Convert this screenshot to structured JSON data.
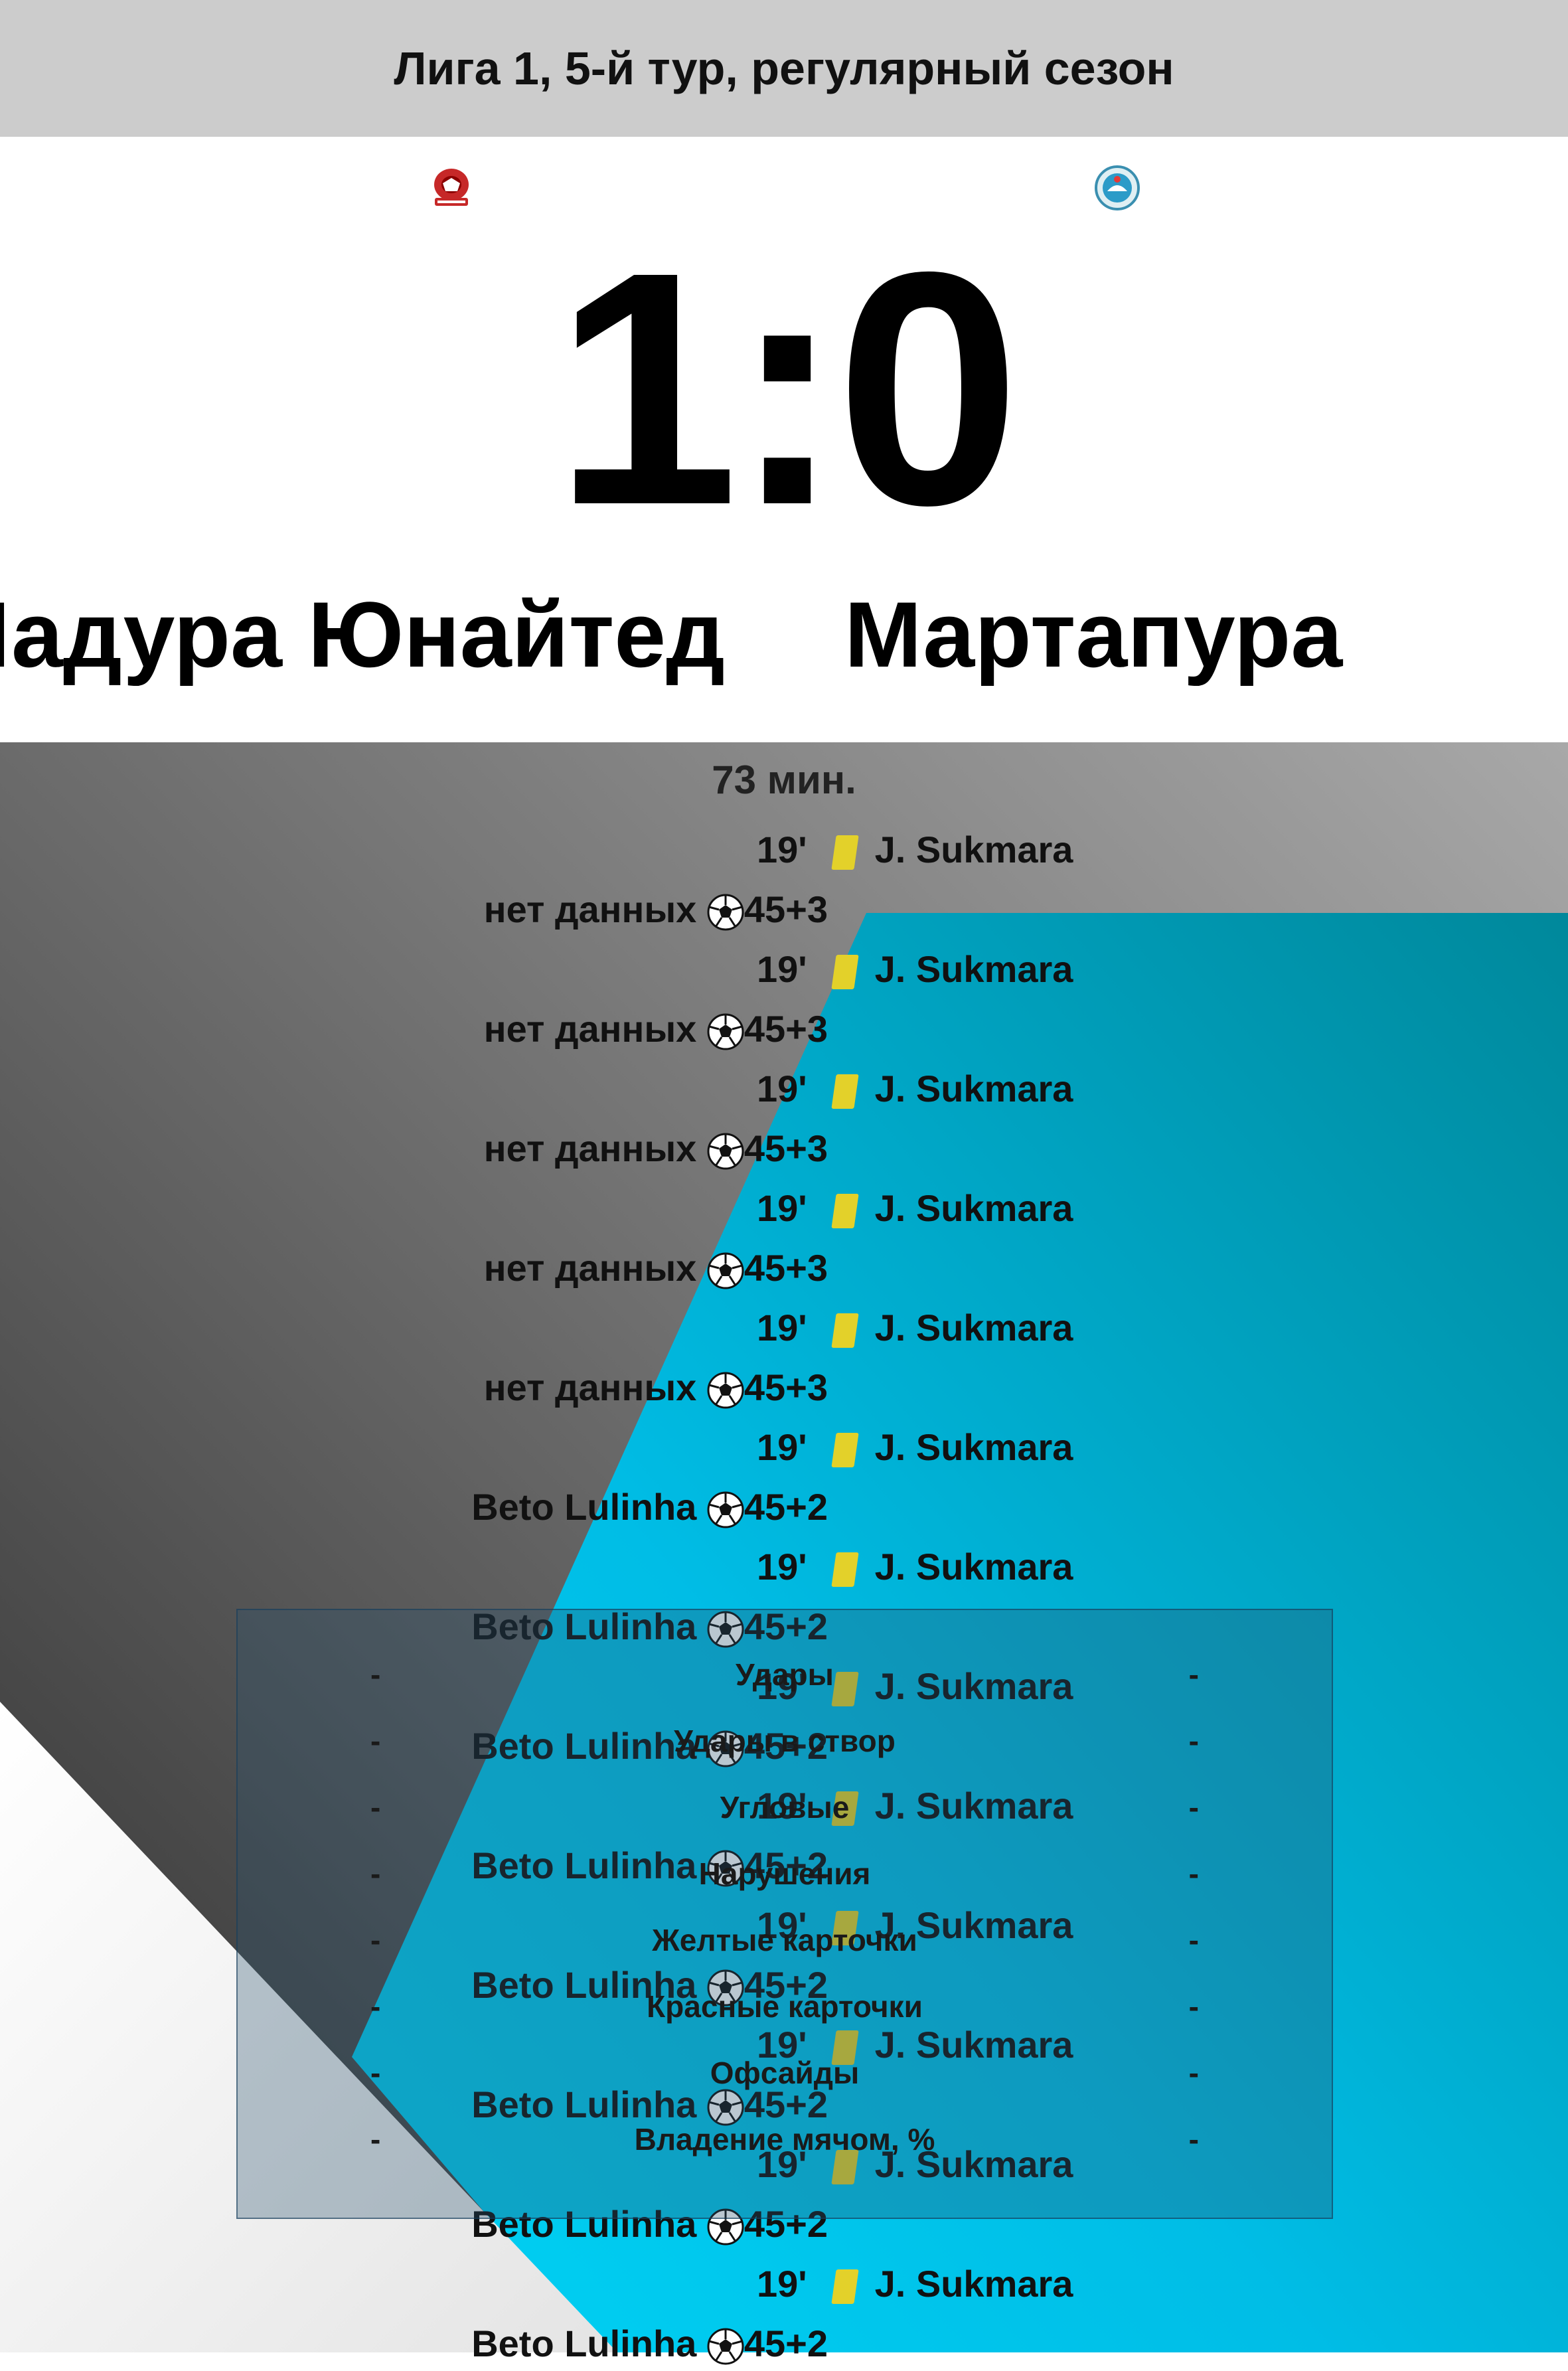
{
  "header": {
    "title": "Лига 1, 5-й тур, регулярный сезон"
  },
  "match": {
    "score": "1:0",
    "home_team": "Мадура Юнайтед",
    "away_team": "Мартапура",
    "minute": "73 мин."
  },
  "events_right": [
    {
      "minute": "19'",
      "player": "J. Sukmara"
    },
    {
      "minute": "19'",
      "player": "J. Sukmara"
    },
    {
      "minute": "19'",
      "player": "J. Sukmara"
    },
    {
      "minute": "19'",
      "player": "J. Sukmara"
    },
    {
      "minute": "19'",
      "player": "J. Sukmara"
    },
    {
      "minute": "19'",
      "player": "J. Sukmara"
    },
    {
      "minute": "19'",
      "player": "J. Sukmara"
    },
    {
      "minute": "19'",
      "player": "J. Sukmara"
    },
    {
      "minute": "19'",
      "player": "J. Sukmara"
    },
    {
      "minute": "19'",
      "player": "J. Sukmara"
    },
    {
      "minute": "19'",
      "player": "J. Sukmara"
    },
    {
      "minute": "19'",
      "player": "J. Sukmara"
    },
    {
      "minute": "19'",
      "player": "J. Sukmara"
    }
  ],
  "events_left": [
    {
      "player": "нет данных",
      "minute": "45+3"
    },
    {
      "player": "нет данных",
      "minute": "45+3"
    },
    {
      "player": "нет данных",
      "minute": "45+3"
    },
    {
      "player": "нет данных",
      "minute": "45+3"
    },
    {
      "player": "нет данных",
      "minute": "45+3"
    },
    {
      "player": "Beto Lulinha",
      "minute": "45+2"
    },
    {
      "player": "Beto Lulinha",
      "minute": "45+2"
    },
    {
      "player": "Beto Lulinha",
      "minute": "45+2"
    },
    {
      "player": "Beto Lulinha",
      "minute": "45+2"
    },
    {
      "player": "Beto Lulinha",
      "minute": "45+2"
    },
    {
      "player": "Beto Lulinha",
      "minute": "45+2"
    },
    {
      "player": "Beto Lulinha",
      "minute": "45+2"
    },
    {
      "player": "Beto Lulinha",
      "minute": "45+2"
    }
  ],
  "stats": [
    {
      "label": "Удары",
      "home": "-",
      "away": "-"
    },
    {
      "label": "Удары в створ",
      "home": "-",
      "away": "-"
    },
    {
      "label": "Угловые",
      "home": "-",
      "away": "-"
    },
    {
      "label": "Нарушения",
      "home": "-",
      "away": "-"
    },
    {
      "label": "Желтые карточки",
      "home": "-",
      "away": "-"
    },
    {
      "label": "Красные карточки",
      "home": "-",
      "away": "-"
    },
    {
      "label": "Офсайды",
      "home": "-",
      "away": "-"
    },
    {
      "label": "Владение мячом, %",
      "home": "-",
      "away": "-"
    }
  ],
  "colors": {
    "header_bg": "#cccccc",
    "card_yellow": "#e3d12a",
    "cyan": "#00c2e8",
    "gray_dark": "#4a4a4a"
  },
  "icons": {
    "home_logo": "madura-united-crest-icon",
    "away_logo": "martapura-crest-icon",
    "card": "yellow-card-icon",
    "goal": "soccer-ball-icon"
  }
}
